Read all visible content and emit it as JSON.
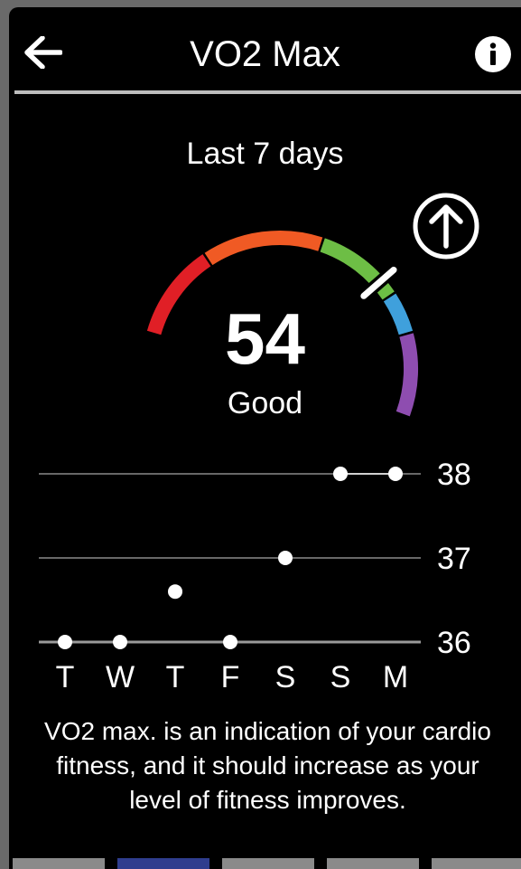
{
  "header": {
    "title": "VO2 Max",
    "back_icon": "arrow-left-icon",
    "info_icon": "info-icon"
  },
  "period_label": "Last 7 days",
  "trend_icon": "arrow-up-circle-icon",
  "gauge": {
    "value": "54",
    "status": "Good",
    "colors": [
      "#e01f26",
      "#f05a24",
      "#6dbe45",
      "#3fa0dc",
      "#8e4db0"
    ],
    "pointer_color": "#ffffff"
  },
  "chart_data": {
    "type": "scatter",
    "categories": [
      "T",
      "W",
      "T",
      "F",
      "S",
      "S",
      "M"
    ],
    "values": [
      36,
      36,
      36.6,
      36,
      37,
      38,
      38
    ],
    "y_ticks": [
      "38",
      "37",
      "36"
    ],
    "ylim": [
      36,
      38
    ],
    "grid": true
  },
  "description": "VO2 max. is an indication of your cardio fitness, and it should increase as your level of fitness improves.",
  "pager": {
    "count": 5,
    "active_index": 1,
    "colors": {
      "active": "#2f3d8e",
      "inactive": "#8a8a8a"
    }
  }
}
